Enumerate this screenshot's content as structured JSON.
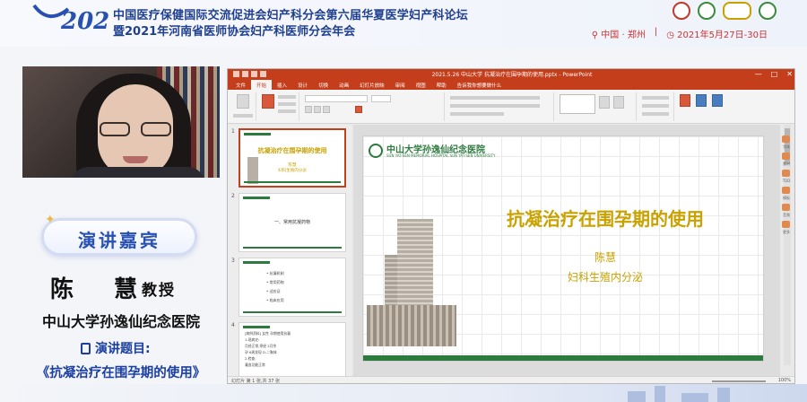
{
  "banner": {
    "line1": "中国医疗保健国际交流促进会妇产科分会第六届华夏医学妇产科论坛",
    "line2": "暨2021年河南省医师协会妇产科医师分会年会",
    "location": "中国 · 郑州",
    "date": "2021年5月27日-30日"
  },
  "speaker": {
    "badge": "演讲嘉宾",
    "name": "陈 慧",
    "title": "教授",
    "organization": "中山大学孙逸仙纪念医院",
    "topic_label": "演讲题目:",
    "topic": "《抗凝治疗在围孕期的使用》"
  },
  "ppt": {
    "doc_title": "2021.5.26 中山大学 抗凝治疗在围孕期的使用.pptx - PowerPoint",
    "window_buttons": [
      "—",
      "□",
      "✕"
    ],
    "tabs": [
      "文件",
      "开始",
      "插入",
      "设计",
      "切换",
      "动画",
      "幻灯片放映",
      "审阅",
      "视图",
      "帮助",
      "告诉我你想要做什么"
    ],
    "active_tab": "开始",
    "thumbnails": [
      {
        "num": "1",
        "title": "抗凝治疗在围孕期的使用",
        "sub1": "陈慧",
        "sub2": "妇科生殖内分泌"
      },
      {
        "num": "2",
        "center": "一、常用抗凝药物"
      },
      {
        "num": "3",
        "bullets": [
          "• 抗凝机制",
          "• 常用药物",
          "• 适应证",
          "• 临床应用"
        ]
      },
      {
        "num": "4",
        "lines": [
          "[病例资料] 女性 孕期使用抗凝",
          "1.现病史:",
          "  月经正常,停经 2月余",
          "  孕 6周发现 D-二聚体",
          "2.检查:",
          "  凝血功能正常"
        ]
      }
    ],
    "slide": {
      "logo_text": "中山大学孙逸仙纪念医院",
      "logo_sub": "SUN YAT-SEN MEMORIAL HOSPITAL SUN YAT-SEN UNIVERSITY",
      "title": "抗凝治疗在围孕期的使用",
      "author": "陈慧",
      "department": "妇科生殖内分泌"
    },
    "status_left": "幻灯片 第 1 张,共 37 张",
    "status_right": "100%",
    "right_rail": [
      "字体",
      "素材",
      "TDD",
      "模板",
      "音频",
      "更多"
    ]
  },
  "colors": {
    "ppt_accent": "#c43e1c",
    "banner_blue": "#1f3f8f",
    "slide_gold": "#c9a200",
    "hospital_green": "#2d7a3e"
  }
}
